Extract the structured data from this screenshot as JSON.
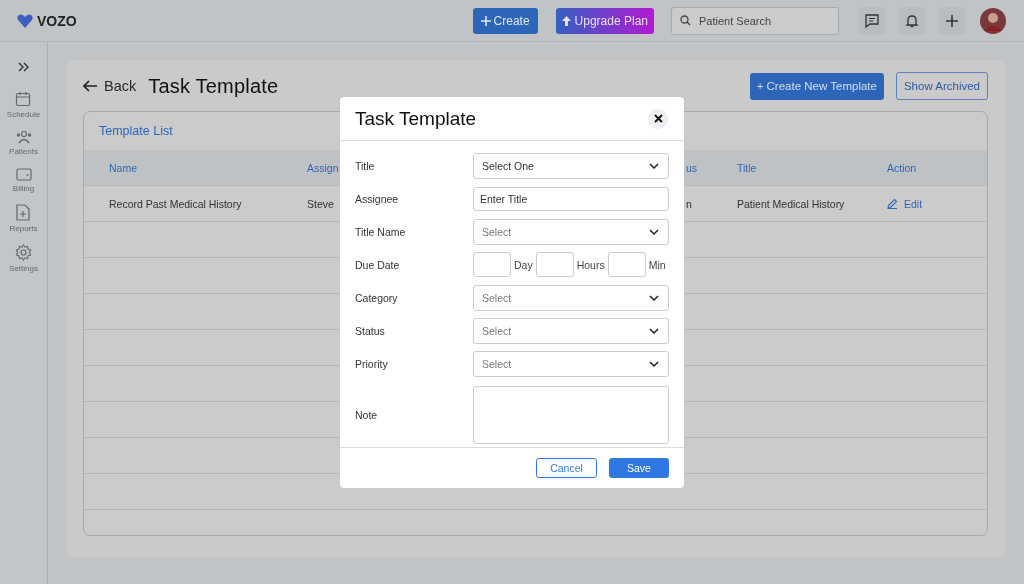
{
  "topbar": {
    "logo": "VOZO",
    "create_button": "Create",
    "upgrade_button": "Upgrade Plan",
    "search": {
      "placeholder": "Patient Search"
    }
  },
  "sidebar": {
    "items": [
      {
        "label": "Schedule"
      },
      {
        "label": "Patients"
      },
      {
        "label": "Billing"
      },
      {
        "label": "Reports"
      },
      {
        "label": "Settings"
      }
    ]
  },
  "page": {
    "back": "Back",
    "title": "Task Template",
    "create_template_button": "+ Create New Template",
    "show_archived_button": "Show Archived"
  },
  "table": {
    "title": "Template List",
    "columns": [
      "Name",
      "Assign",
      "us",
      "Title",
      "Action"
    ],
    "rows": [
      {
        "cells": [
          "Record Past Medical History",
          "Steve",
          "n",
          "Patient Medical History"
        ],
        "action": "Edit"
      }
    ]
  },
  "modal": {
    "title": "Task Template",
    "fields": [
      {
        "label": "Title",
        "kind": "select",
        "value": "Select One"
      },
      {
        "label": "Assignee",
        "kind": "input",
        "placeholder": "Enter Title"
      },
      {
        "label": "Title Name",
        "kind": "select",
        "placeholder": "Select"
      },
      {
        "label": "Due Date",
        "kind": "duration",
        "units": [
          "Day",
          "Hours",
          "Min"
        ]
      },
      {
        "label": "Category",
        "kind": "select",
        "placeholder": "Select"
      },
      {
        "label": "Status",
        "kind": "select",
        "placeholder": "Select"
      },
      {
        "label": "Priority",
        "kind": "select",
        "placeholder": "Select"
      },
      {
        "label": "Note",
        "kind": "textarea"
      }
    ],
    "cancel_button": "Cancel",
    "save_button": "Save"
  }
}
